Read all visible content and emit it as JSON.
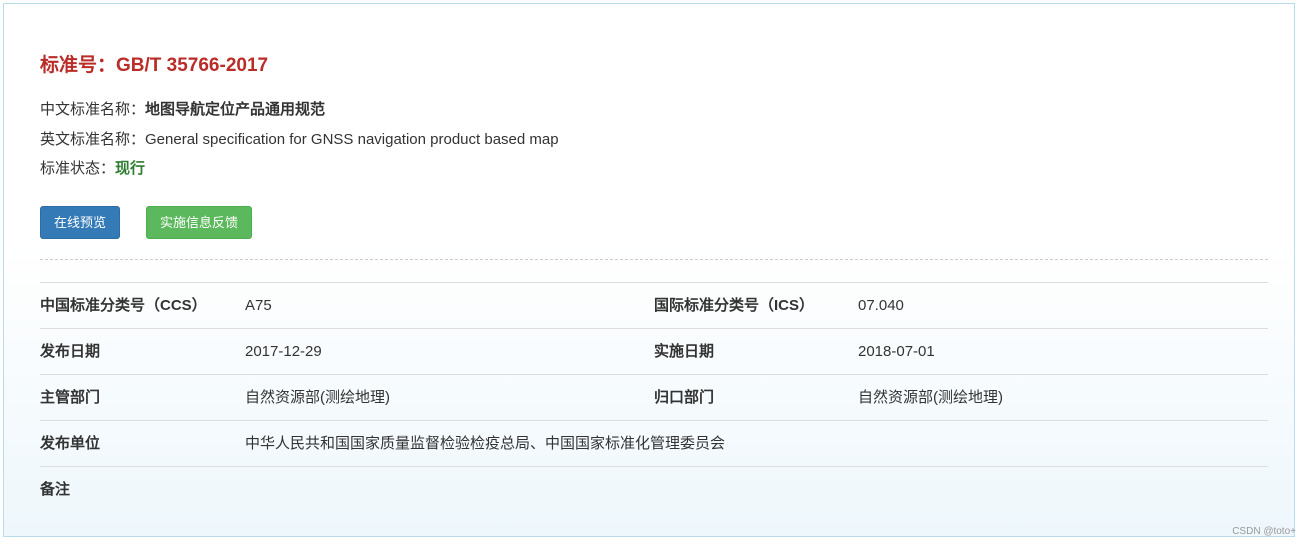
{
  "header": {
    "title": "标准号：GB/T 35766-2017"
  },
  "info": {
    "cn_name_label": "中文标准名称：",
    "cn_name_value": "地图导航定位产品通用规范",
    "en_name_label": "英文标准名称：",
    "en_name_value": "General specification for GNSS navigation product based map",
    "status_label": "标准状态：",
    "status_value": "现行"
  },
  "buttons": {
    "preview": "在线预览",
    "feedback": "实施信息反馈"
  },
  "colors": {
    "title": "#b92c28",
    "status": "#2e7d32",
    "preview_button": "#337ab7",
    "feedback_button": "#5cb85c"
  },
  "table": {
    "rows": [
      {
        "k1": "中国标准分类号（CCS）",
        "v1": "A75",
        "k2": "国际标准分类号（ICS）",
        "v2": "07.040"
      },
      {
        "k1": "发布日期",
        "v1": "2017-12-29",
        "k2": "实施日期",
        "v2": "2018-07-01"
      },
      {
        "k1": "主管部门",
        "v1": "自然资源部(测绘地理)",
        "k2": "归口部门",
        "v2": "自然资源部(测绘地理)"
      },
      {
        "k1": "发布单位",
        "v1": "中华人民共和国国家质量监督检验检疫总局、中国国家标准化管理委员会"
      },
      {
        "k1": "备注"
      }
    ]
  },
  "watermark": "CSDN @toto+"
}
